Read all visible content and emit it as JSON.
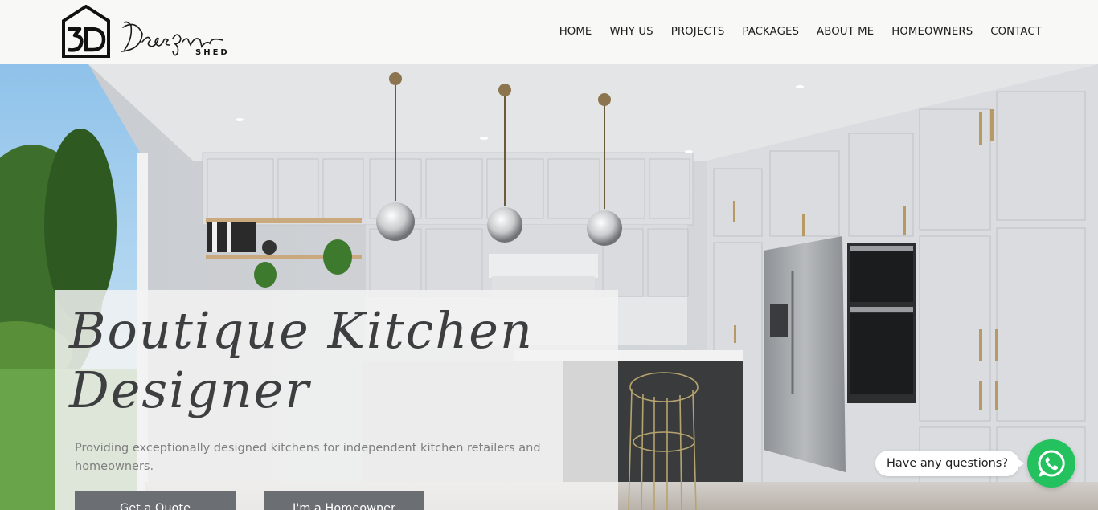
{
  "brand": {
    "logo_text": "Design Shed",
    "logo_mark": "3D"
  },
  "nav": {
    "items": [
      "HOME",
      "WHY US",
      "PROJECTS",
      "PACKAGES",
      "ABOUT ME",
      "HOMEOWNERS",
      "CONTACT"
    ]
  },
  "hero": {
    "headline": "Boutique Kitchen Designer",
    "subtitle": "Providing exceptionally designed kitchens for independent kitchen retailers and homeowners.",
    "primary_button": "Get a Quote",
    "secondary_button": "I'm a Homeowner"
  },
  "chat": {
    "prompt": "Have any questions?",
    "icon": "whatsapp-icon"
  },
  "colors": {
    "button_bg": "#6b6f74",
    "whatsapp_green": "#23c25f",
    "text_dark": "#1b1b1b"
  }
}
